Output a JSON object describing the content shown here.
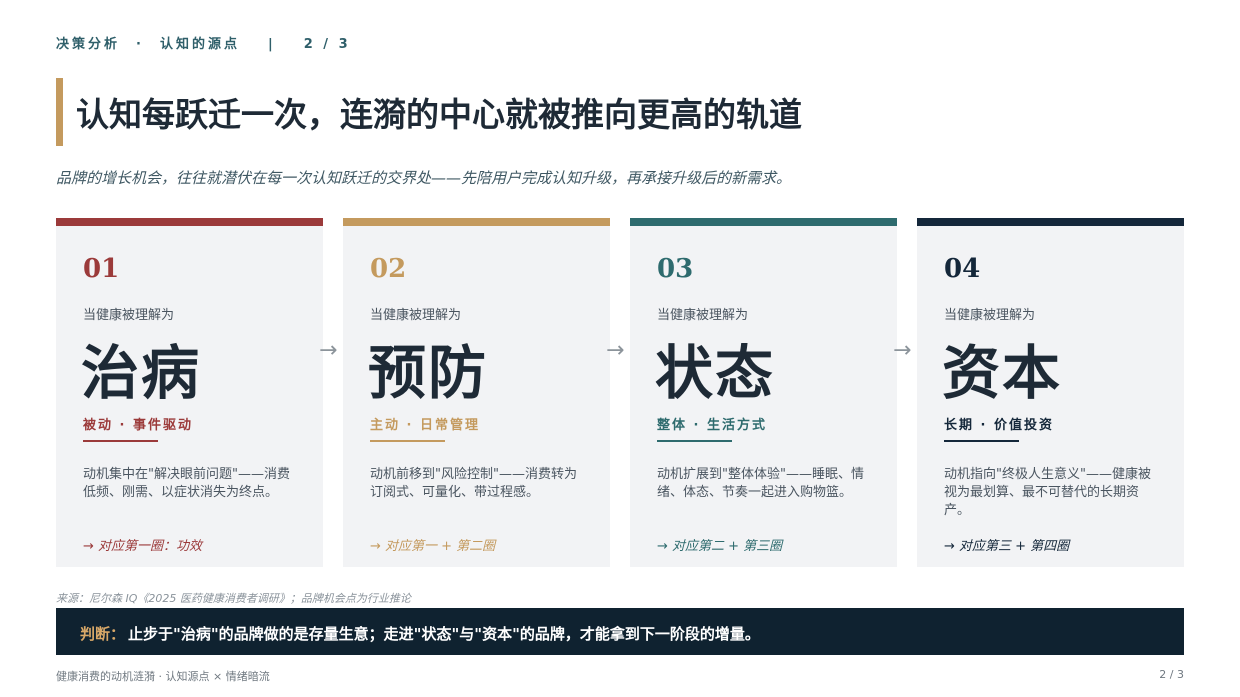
{
  "header": {
    "section": "决策分析",
    "dot": "·",
    "topic": "认知的源点",
    "pipe": "|",
    "page": "2 / 3"
  },
  "title": "认知每跃迁一次，连漪的中心就被推向更高的轨道",
  "subtitle": "品牌的增长机会，往往就潜伏在每一次认知跃迁的交界处——先陪用户完成认知升级，再承接升级后的新需求。",
  "arrow_glyph": "→",
  "cards": [
    {
      "num": "01",
      "lead": "当健康被理解为",
      "big": "治病",
      "tag": "被动 · 事件驱动",
      "desc": "动机集中在\"解决眼前问题\"——消费低频、刚需、以症状消失为终点。",
      "maps": "→ 对应第一圈：功效",
      "color": "#9b3a3a"
    },
    {
      "num": "02",
      "lead": "当健康被理解为",
      "big": "预防",
      "tag": "主动 · 日常管理",
      "desc": "动机前移到\"风险控制\"——消费转为订阅式、可量化、带过程感。",
      "maps": "→ 对应第一 + 第二圈",
      "color": "#c49a5e"
    },
    {
      "num": "03",
      "lead": "当健康被理解为",
      "big": "状态",
      "tag": "整体 · 生活方式",
      "desc": "动机扩展到\"整体体验\"——睡眠、情绪、体态、节奏一起进入购物篮。",
      "maps": "→ 对应第二 + 第三圈",
      "color": "#2e6b6e"
    },
    {
      "num": "04",
      "lead": "当健康被理解为",
      "big": "资本",
      "tag": "长期 · 价值投资",
      "desc": "动机指向\"终极人生意义\"——健康被视为最划算、最不可替代的长期资产。",
      "maps": "→ 对应第三 + 第四圈",
      "color": "#14273a"
    }
  ],
  "source": "来源：尼尔森 IQ《2025 医药健康消费者调研》；品牌机会点为行业推论",
  "verdict": {
    "label": "判断：",
    "text": "止步于\"治病\"的品牌做的是存量生意；走进\"状态\"与\"资本\"的品牌，才能拿到下一阶段的增量。"
  },
  "footer": {
    "left": "健康消费的动机涟漪 · 认知源点 × 情绪暗流",
    "right": "2 / 3"
  }
}
